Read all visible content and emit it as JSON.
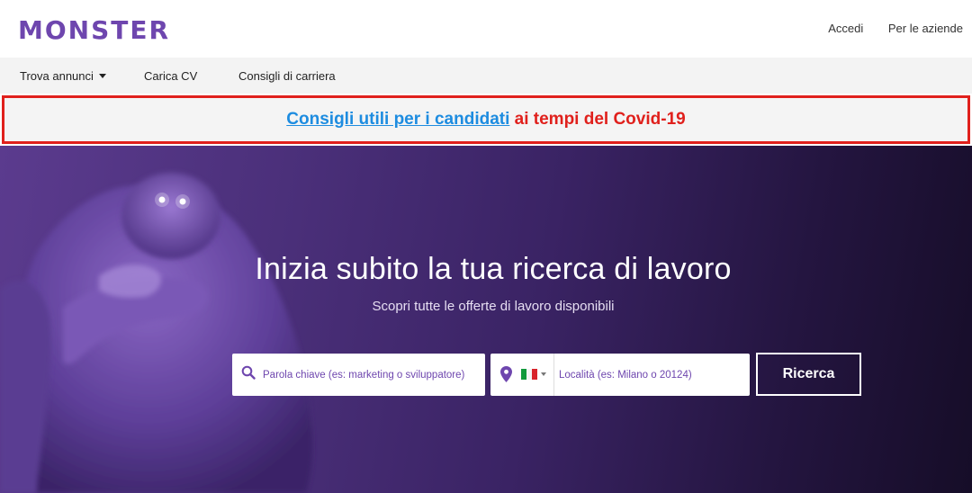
{
  "brand": {
    "logo_text": "MONSTER",
    "color": "#6e46ae"
  },
  "header": {
    "links": [
      "Accedi",
      "Per le aziende"
    ]
  },
  "nav": {
    "items": [
      "Trova annunci",
      "Carica CV",
      "Consigli di carriera"
    ]
  },
  "banner": {
    "link_text": "Consigli utili per i candidati",
    "rest_text": " ai tempi del Covid-19",
    "border_color": "#e0201c",
    "link_color": "#1d8ce0"
  },
  "hero": {
    "title": "Inizia subito la tua ricerca di lavoro",
    "subtitle": "Scopri tutte le offerte di lavoro disponibili",
    "keyword_placeholder": "Parola chiave (es: marketing o sviluppatore)",
    "location_placeholder": "Località (es: Milano o 20124)",
    "country_flag": "italy-flag-icon",
    "search_button": "Ricerca"
  }
}
